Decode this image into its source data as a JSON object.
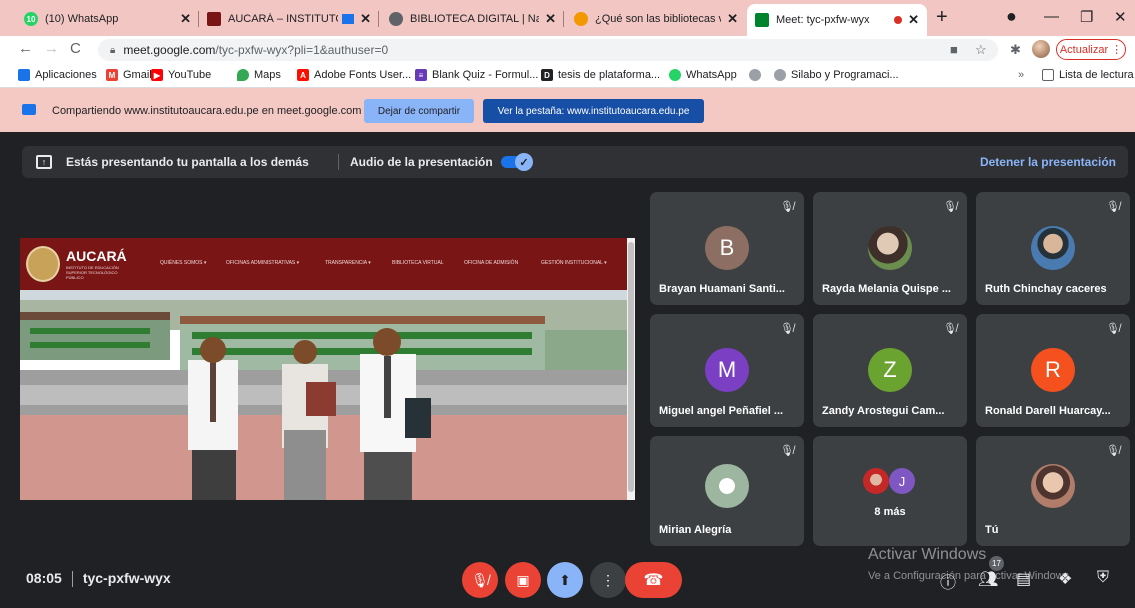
{
  "tabs": [
    {
      "title": "(10) WhatsApp",
      "fav_color": "#25d366",
      "fav_label": "10"
    },
    {
      "title": "AUCARÁ – INSTITUTO TE",
      "fav_color": "#7a1516",
      "fav_label": ""
    },
    {
      "title": "BIBLIOTECA DIGITAL | Navega",
      "fav_color": "#5f6368",
      "fav_label": ""
    },
    {
      "title": "¿Qué son las bibliotecas virtu",
      "fav_color": "#f29900",
      "fav_label": ""
    },
    {
      "title": "Meet: tyc-pxfw-wyx",
      "fav_color": "#00832d",
      "fav_label": ""
    }
  ],
  "omnibox": {
    "host": "meet.google.com",
    "path": "/tyc-pxfw-wyx?pli=1&authuser=0"
  },
  "update_label": "Actualizar",
  "bookmarks": [
    {
      "label": "Aplicaciones",
      "icon": "apps-icon",
      "color": "#1a73e8"
    },
    {
      "label": "Gmail",
      "icon": "gmail-icon",
      "color": "#ea4335"
    },
    {
      "label": "YouTube",
      "icon": "youtube-icon",
      "color": "#ff0000"
    },
    {
      "label": "Maps",
      "icon": "maps-icon",
      "color": "#34a853"
    },
    {
      "label": "Adobe Fonts User...",
      "icon": "adobe-icon",
      "color": "#fa0f00"
    },
    {
      "label": "Blank Quiz - Formul...",
      "icon": "forms-icon",
      "color": "#673ab7"
    },
    {
      "label": "tesis de plataforma...",
      "icon": "doc-icon",
      "color": "#202124"
    },
    {
      "label": "WhatsApp",
      "icon": "whatsapp-icon",
      "color": "#25d366"
    },
    {
      "label": "Silabo y Programaci...",
      "icon": "globe-icon",
      "color": "#5f6368"
    }
  ],
  "reading_list": "Lista de lectura",
  "more_bookmarks": "»",
  "share_bar": {
    "text": "Compartiendo www.institutoaucara.edu.pe en meet.google.com",
    "stop_label": "Dejar de compartir",
    "view_label": "Ver la pestaña: www.institutoaucara.edu.pe"
  },
  "present_bar": {
    "text": "Estás presentando tu pantalla a los demás",
    "audio_label": "Audio de la presentación",
    "stop_label": "Detener la presentación"
  },
  "shared_site": {
    "name": "AUCARÁ",
    "subtitle": "INSTITUTO DE EDUCACIÓN SUPERIOR TECNOLÓGICO PÚBLICO",
    "menu": [
      "QUIÉNES SOMOS ▾",
      "OFICINAS ADMINISTRATIVAS ▾",
      "TRANSPARENCIA ▾",
      "BIBLIOTECA VIRTUAL",
      "OFICINA DE ADMISIÓN",
      "GESTIÓN INSTITUCIONAL ▾"
    ]
  },
  "participants": [
    {
      "name": "Brayan Huamani Santi...",
      "initial": "B",
      "color": "#8d6e63",
      "photo": false
    },
    {
      "name": "Rayda Melania Quispe ...",
      "initial": "",
      "color": "#6b8e4e",
      "photo": true
    },
    {
      "name": "Ruth Chinchay caceres",
      "initial": "",
      "color": "#4a7bb0",
      "photo": true
    },
    {
      "name": "Miguel angel Peñafiel ...",
      "initial": "M",
      "color": "#7b3fc4",
      "photo": false
    },
    {
      "name": "Zandy Arostegui Cam...",
      "initial": "Z",
      "color": "#6aa32f",
      "photo": false
    },
    {
      "name": "Ronald Darell Huarcay...",
      "initial": "R",
      "color": "#f4511e",
      "photo": false
    },
    {
      "name": "Mirian Alegría",
      "initial": "",
      "color": "#9db6a0",
      "photo": true
    },
    {
      "name": "Tú",
      "initial": "",
      "color": "#b07d6a",
      "photo": true
    }
  ],
  "more_tile": {
    "label": "8 más",
    "initial": "J",
    "color": "#7e57c2"
  },
  "meeting": {
    "time": "08:05",
    "code": "tyc-pxfw-wyx"
  },
  "people_count": "17",
  "watermark": {
    "line1": "Activar Windows",
    "line2": "Ve a Configuración para activar Windows."
  }
}
